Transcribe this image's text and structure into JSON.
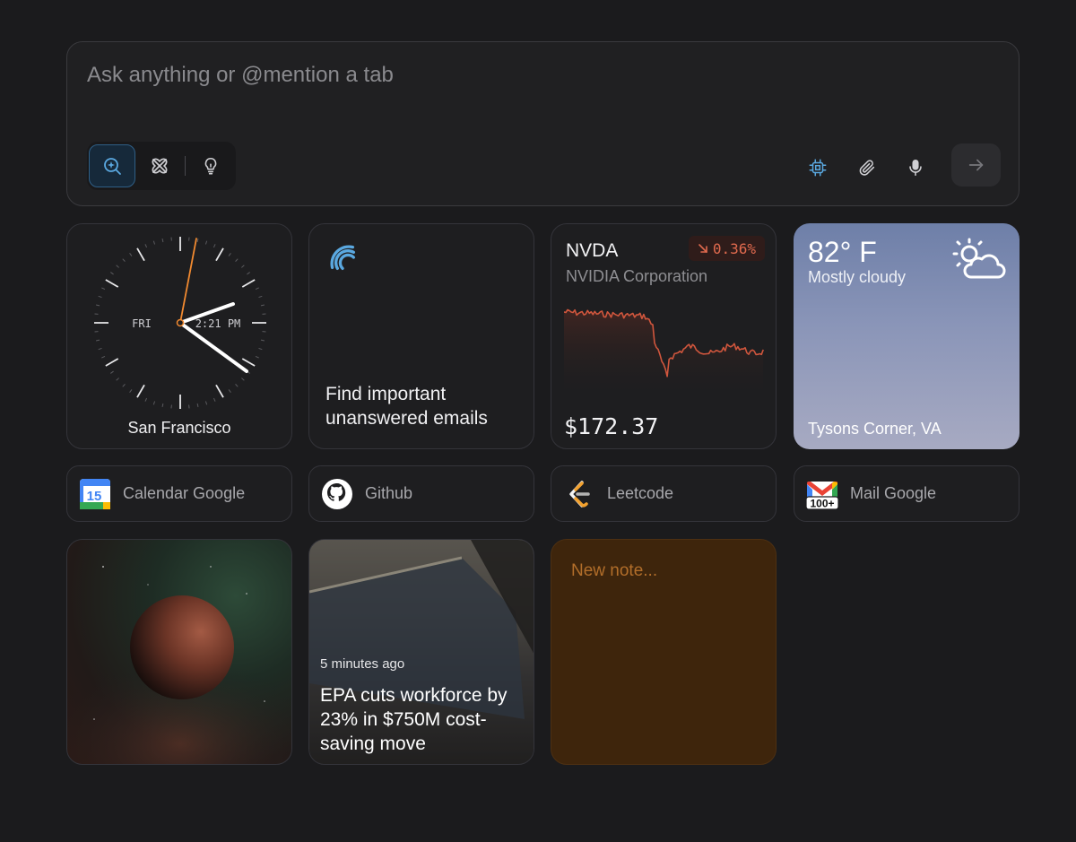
{
  "prompt": {
    "placeholder": "Ask anything or @mention a tab",
    "modes": [
      {
        "name": "search",
        "icon": "search-sparkle-icon",
        "active": true
      },
      {
        "name": "agent",
        "icon": "agent-icon",
        "active": false
      },
      {
        "name": "ideas",
        "icon": "lightbulb-icon",
        "active": false
      }
    ],
    "tools": [
      "chip-icon",
      "paperclip-icon",
      "microphone-icon"
    ],
    "send_icon": "arrow-right-icon",
    "accent_color": "#5aa8e0"
  },
  "clock": {
    "day": "FRI",
    "time": "2:21 PM",
    "city": "San Francisco"
  },
  "email_widget": {
    "text": "Find important unanswered emails"
  },
  "stock": {
    "ticker": "NVDA",
    "company": "NVIDIA Corporation",
    "change": "0.36%",
    "direction": "down",
    "price": "$172.37",
    "line_color": "#d0563d"
  },
  "weather": {
    "temperature": "82° F",
    "condition": "Mostly cloudy",
    "location": "Tysons Corner, VA",
    "icon": "partly-cloudy-icon"
  },
  "shortcuts": [
    {
      "label": "Calendar Google",
      "icon": "google-calendar-icon",
      "badge": "15"
    },
    {
      "label": "Github",
      "icon": "github-icon"
    },
    {
      "label": "Leetcode",
      "icon": "leetcode-icon"
    },
    {
      "label": "Mail Google",
      "icon": "gmail-icon",
      "badge": "100+"
    }
  ],
  "news": {
    "time": "5 minutes ago",
    "title": "EPA cuts workforce by 23% in $750M cost-saving move"
  },
  "note": {
    "placeholder": "New note..."
  }
}
